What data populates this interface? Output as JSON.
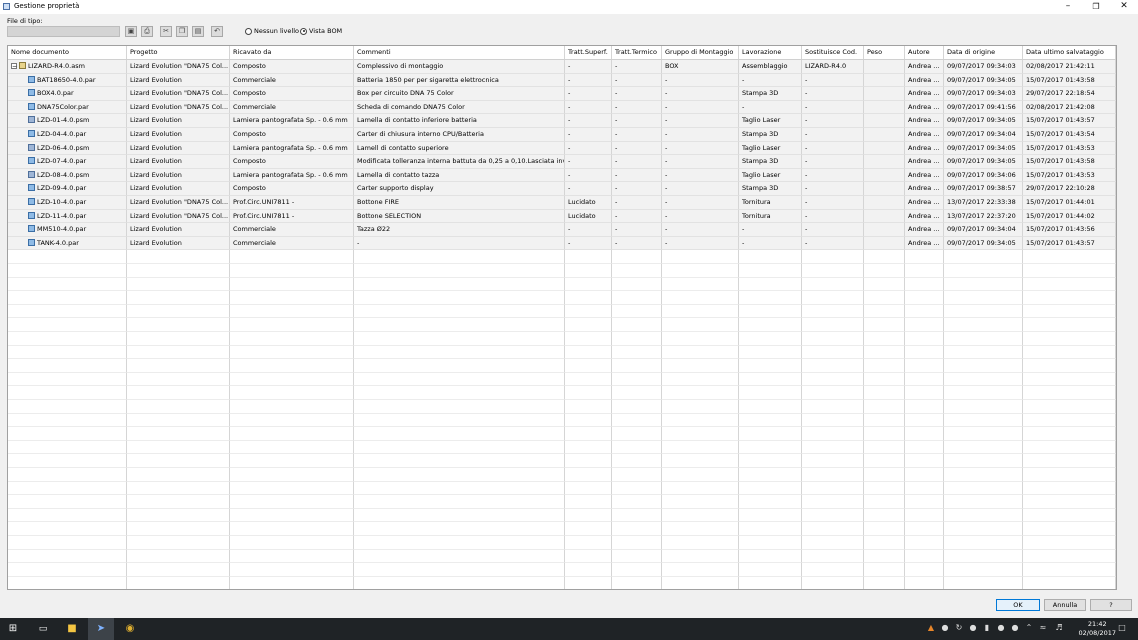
{
  "window": {
    "title": "Gestione proprietà",
    "minimize_icon": "minimize-icon",
    "maximize_icon": "restore-icon",
    "close_icon": "close-icon"
  },
  "toolbar": {
    "file_type_label": "File di tipo:",
    "file_type_value": "",
    "tools": [
      "save-icon",
      "print-icon",
      "cut-icon",
      "copy-icon",
      "paste-icon",
      "undo-icon"
    ],
    "radio_none": "Nessun livello",
    "radio_bom": "Vista BOM",
    "selected_radio": "Vista BOM"
  },
  "table": {
    "columns": [
      "Nome documento",
      "Progetto",
      "Ricavato da",
      "Commenti",
      "Tratt.Superf.",
      "Tratt.Termico",
      "Gruppo di Montaggio",
      "Lavorazione",
      "Sostituisce Cod.",
      "Peso",
      "Autore",
      "Data di origine",
      "Data ultimo salvataggio"
    ],
    "rows": [
      {
        "type": "asm",
        "level": 0,
        "cells": [
          "LIZARD-R4.0.asm",
          "Lizard Evolution \"DNA75 Col...",
          "Composto",
          "Complessivo di montaggio",
          "-",
          "-",
          "BOX",
          "Assemblaggio",
          "LIZARD-R4.0",
          "",
          "Andrea ...",
          "09/07/2017 09:34:03",
          "02/08/2017 21:42:11"
        ]
      },
      {
        "type": "par",
        "level": 1,
        "cells": [
          "BAT18650-4.0.par",
          "Lizard Evolution",
          "Commerciale",
          "Batteria 1850 per per sigaretta elettrocnica",
          "-",
          "-",
          "-",
          "-",
          "-",
          "",
          "Andrea ...",
          "09/07/2017 09:34:05",
          "15/07/2017 01:43:58"
        ]
      },
      {
        "type": "par",
        "level": 1,
        "cells": [
          "BOX4.0.par",
          "Lizard Evolution \"DNA75 Col...",
          "Composto",
          "Box per circuito DNA 75 Color",
          "-",
          "-",
          "-",
          "Stampa 3D",
          "-",
          "",
          "Andrea ...",
          "09/07/2017 09:34:03",
          "29/07/2017 22:18:54"
        ]
      },
      {
        "type": "par",
        "level": 1,
        "cells": [
          "DNA75Color.par",
          "Lizard Evolution \"DNA75 Col...",
          "Commerciale",
          "Scheda di comando DNA75 Color",
          "-",
          "-",
          "-",
          "-",
          "-",
          "",
          "Andrea ...",
          "09/07/2017 09:41:56",
          "02/08/2017 21:42:08"
        ]
      },
      {
        "type": "psm",
        "level": 1,
        "cells": [
          "LZD-01-4.0.psm",
          "Lizard Evolution",
          "Lamiera pantografata Sp. - 0.6 mm",
          "Lamella di contatto inferiore batteria",
          "-",
          "-",
          "-",
          "Taglio Laser",
          "-",
          "",
          "Andrea ...",
          "09/07/2017 09:34:05",
          "15/07/2017 01:43:57"
        ]
      },
      {
        "type": "par",
        "level": 1,
        "cells": [
          "LZD-04-4.0.par",
          "Lizard Evolution",
          "Composto",
          "Carter di chiusura interno CPU/Batteria",
          "-",
          "-",
          "-",
          "Stampa 3D",
          "-",
          "",
          "Andrea ...",
          "09/07/2017 09:34:04",
          "15/07/2017 01:43:54"
        ]
      },
      {
        "type": "psm",
        "level": 1,
        "cells": [
          "LZD-06-4.0.psm",
          "Lizard Evolution",
          "Lamiera pantografata Sp. - 0.6 mm",
          "Lamell di contatto superiore",
          "-",
          "-",
          "-",
          "Taglio Laser",
          "-",
          "",
          "Andrea ...",
          "09/07/2017 09:34:05",
          "15/07/2017 01:43:53"
        ]
      },
      {
        "type": "par",
        "level": 1,
        "cells": [
          "LZD-07-4.0.par",
          "Lizard Evolution",
          "Composto",
          "Modificata tolleranza interna battuta da 0,25 a 0,10.Lasciata inva...",
          "-",
          "-",
          "-",
          "Stampa 3D",
          "-",
          "",
          "Andrea ...",
          "09/07/2017 09:34:05",
          "15/07/2017 01:43:58"
        ]
      },
      {
        "type": "psm",
        "level": 1,
        "cells": [
          "LZD-08-4.0.psm",
          "Lizard Evolution",
          "Lamiera pantografata Sp. - 0.6 mm",
          "Lamella di contatto tazza",
          "-",
          "-",
          "-",
          "Taglio Laser",
          "-",
          "",
          "Andrea ...",
          "09/07/2017 09:34:06",
          "15/07/2017 01:43:53"
        ]
      },
      {
        "type": "par",
        "level": 1,
        "cells": [
          "LZD-09-4.0.par",
          "Lizard Evolution",
          "Composto",
          "Carter supporto display",
          "-",
          "-",
          "-",
          "Stampa 3D",
          "-",
          "",
          "Andrea ...",
          "09/07/2017 09:38:57",
          "29/07/2017 22:10:28"
        ]
      },
      {
        "type": "par",
        "level": 1,
        "cells": [
          "LZD-10-4.0.par",
          "Lizard Evolution \"DNA75 Col...",
          "Prof.Circ.UNI7811 -",
          "Bottone FIRE",
          "Lucidato",
          "-",
          "-",
          "Tornitura",
          "-",
          "",
          "Andrea ...",
          "13/07/2017 22:33:38",
          "15/07/2017 01:44:01"
        ]
      },
      {
        "type": "par",
        "level": 1,
        "cells": [
          "LZD-11-4.0.par",
          "Lizard Evolution \"DNA75 Col...",
          "Prof.Circ.UNI7811 -",
          "Bottone SELECTION",
          "Lucidato",
          "-",
          "-",
          "Tornitura",
          "-",
          "",
          "Andrea ...",
          "13/07/2017 22:37:20",
          "15/07/2017 01:44:02"
        ]
      },
      {
        "type": "par",
        "level": 1,
        "cells": [
          "MM510-4.0.par",
          "Lizard Evolution",
          "Commerciale",
          "Tazza Ø22",
          "-",
          "-",
          "-",
          "-",
          "-",
          "",
          "Andrea ...",
          "09/07/2017 09:34:04",
          "15/07/2017 01:43:56"
        ]
      },
      {
        "type": "par",
        "level": 1,
        "cells": [
          "TANK-4.0.par",
          "Lizard Evolution",
          "Commerciale",
          "-",
          "-",
          "-",
          "-",
          "-",
          "-",
          "",
          "Andrea ...",
          "09/07/2017 09:34:05",
          "15/07/2017 01:43:57"
        ]
      }
    ]
  },
  "buttons": {
    "ok": "OK",
    "cancel": "Annulla",
    "help": "?"
  },
  "taskbar": {
    "time": "21:42",
    "date": "02/08/2017",
    "pinned": [
      "windows-start-icon",
      "task-view-icon",
      "file-explorer-icon",
      "solid-edge-icon",
      "chrome-icon"
    ]
  }
}
